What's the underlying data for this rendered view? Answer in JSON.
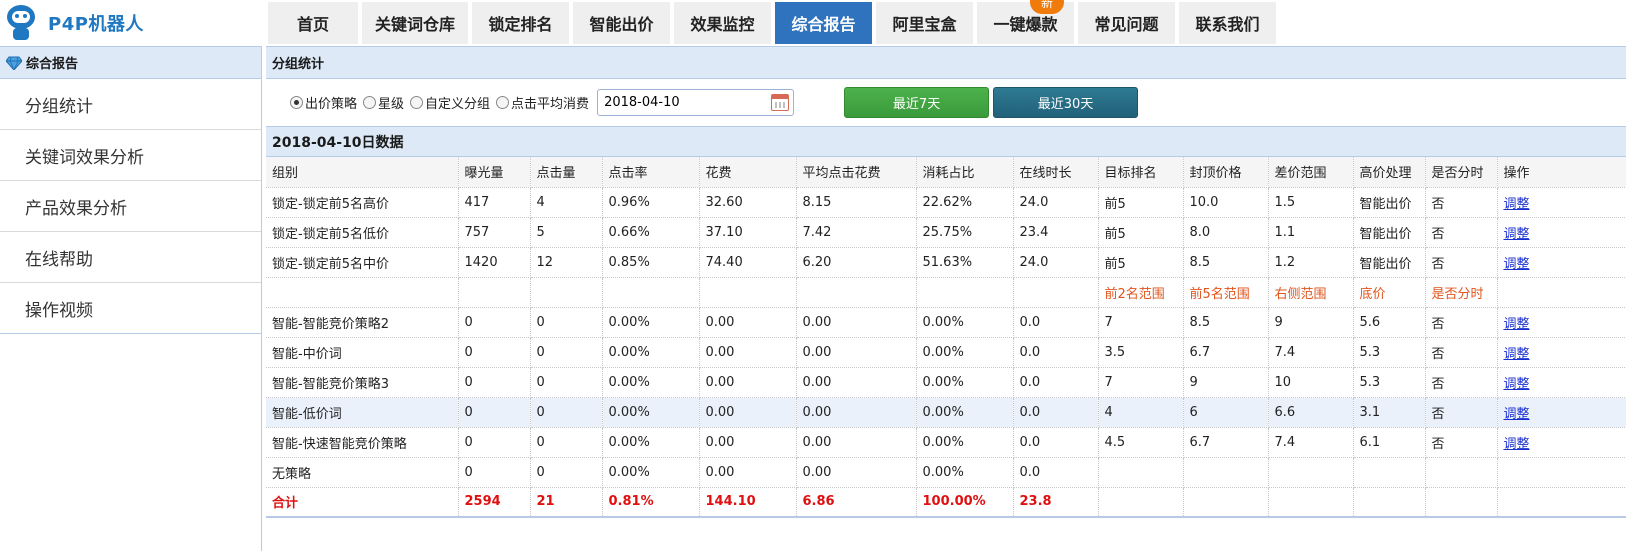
{
  "app": {
    "title": "P4P机器人",
    "nav": [
      {
        "label": "首页",
        "active": false
      },
      {
        "label": "关键词仓库",
        "active": false
      },
      {
        "label": "锁定排名",
        "active": false
      },
      {
        "label": "智能出价",
        "active": false
      },
      {
        "label": "效果监控",
        "active": false
      },
      {
        "label": "综合报告",
        "active": true
      },
      {
        "label": "阿里宝盒",
        "active": false
      },
      {
        "label": "一键爆款",
        "active": false,
        "badge": "新"
      },
      {
        "label": "常见问题",
        "active": false
      },
      {
        "label": "联系我们",
        "active": false
      }
    ]
  },
  "sidebar": {
    "title": "综合报告",
    "items": [
      {
        "label": "分组统计"
      },
      {
        "label": "关键词效果分析"
      },
      {
        "label": "产品效果分析"
      },
      {
        "label": "在线帮助"
      },
      {
        "label": "操作视频"
      }
    ]
  },
  "main": {
    "section_title": "分组统计",
    "filters": {
      "radios": [
        {
          "label": "出价策略",
          "checked": true
        },
        {
          "label": "星级",
          "checked": false
        },
        {
          "label": "自定义分组",
          "checked": false
        },
        {
          "label": "点击平均消费",
          "checked": false
        }
      ],
      "date_value": "2018-04-10",
      "btn_7days": "最近7天",
      "btn_30days": "最近30天"
    },
    "data_title": "2018-04-10日数据",
    "table": {
      "headers": [
        "组别",
        "曝光量",
        "点击量",
        "点击率",
        "花费",
        "平均点击花费",
        "消耗占比",
        "在线时长",
        "目标排名",
        "封顶价格",
        "差价范围",
        "高价处理",
        "是否分时",
        "操作"
      ],
      "rows": [
        {
          "type": "data",
          "cells": [
            "锁定-锁定前5名高价",
            "417",
            "4",
            "0.96%",
            "32.60",
            "8.15",
            "22.62%",
            "24.0",
            "前5",
            "10.0",
            "1.5",
            "智能出价",
            "否",
            "调整"
          ]
        },
        {
          "type": "data",
          "cells": [
            "锁定-锁定前5名低价",
            "757",
            "5",
            "0.66%",
            "37.10",
            "7.42",
            "25.75%",
            "23.4",
            "前5",
            "8.0",
            "1.1",
            "智能出价",
            "否",
            "调整"
          ]
        },
        {
          "type": "data",
          "cells": [
            "锁定-锁定前5名中价",
            "1420",
            "12",
            "0.85%",
            "74.40",
            "6.20",
            "51.63%",
            "24.0",
            "前5",
            "8.5",
            "1.2",
            "智能出价",
            "否",
            "调整"
          ]
        },
        {
          "type": "note",
          "cells": [
            "",
            "",
            "",
            "",
            "",
            "",
            "",
            "",
            "前2名范围",
            "前5名范围",
            "右侧范围",
            "底价",
            "是否分时",
            ""
          ]
        },
        {
          "type": "data",
          "cells": [
            "智能-智能竞价策略2",
            "0",
            "0",
            "0.00%",
            "0.00",
            "0.00",
            "0.00%",
            "0.0",
            "7",
            "8.5",
            "9",
            "5.6",
            "否",
            "调整"
          ]
        },
        {
          "type": "data",
          "cells": [
            "智能-中价词",
            "0",
            "0",
            "0.00%",
            "0.00",
            "0.00",
            "0.00%",
            "0.0",
            "3.5",
            "6.7",
            "7.4",
            "5.3",
            "否",
            "调整"
          ]
        },
        {
          "type": "data",
          "cells": [
            "智能-智能竞价策略3",
            "0",
            "0",
            "0.00%",
            "0.00",
            "0.00",
            "0.00%",
            "0.0",
            "7",
            "9",
            "10",
            "5.3",
            "否",
            "调整"
          ]
        },
        {
          "type": "hl",
          "cells": [
            "智能-低价词",
            "0",
            "0",
            "0.00%",
            "0.00",
            "0.00",
            "0.00%",
            "0.0",
            "4",
            "6",
            "6.6",
            "3.1",
            "否",
            "调整"
          ]
        },
        {
          "type": "data",
          "cells": [
            "智能-快速智能竞价策略",
            "0",
            "0",
            "0.00%",
            "0.00",
            "0.00",
            "0.00%",
            "0.0",
            "4.5",
            "6.7",
            "7.4",
            "6.1",
            "否",
            "调整"
          ]
        },
        {
          "type": "data",
          "cells": [
            "无策略",
            "0",
            "0",
            "0.00%",
            "0.00",
            "0.00",
            "0.00%",
            "0.0",
            "",
            "",
            "",
            "",
            "",
            ""
          ]
        },
        {
          "type": "total",
          "cells": [
            "合计",
            "2594",
            "21",
            "0.81%",
            "144.10",
            "6.86",
            "100.00%",
            "23.8",
            "",
            "",
            "",
            "",
            "",
            ""
          ]
        }
      ]
    }
  },
  "colors": {
    "brand": "#1f78c1",
    "nav_active": "#2f72be",
    "header_bg": "#dde9f7",
    "link": "#1a2fd0",
    "note": "#e2541c",
    "total": "#e01010",
    "btn_green": "#3a9a3a",
    "btn_teal": "#216179",
    "badge": "#f07a0a"
  }
}
